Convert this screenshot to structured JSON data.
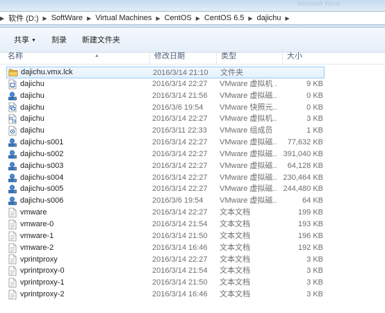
{
  "window": {
    "ghost_title": "Microsoft Word"
  },
  "address_bar": {
    "crumbs": [
      "软件 (D:)",
      "SoftWare",
      "Virtual Machines",
      "CentOS",
      "CentOS 6.5",
      "dajichu"
    ]
  },
  "toolbar": {
    "share_label": "共享",
    "burn_label": "刻录",
    "new_folder_label": "新建文件夹"
  },
  "columns": {
    "name": "名称",
    "modified": "修改日期",
    "type": "类型",
    "size": "大小"
  },
  "files": [
    {
      "name": "dajichu.vmx.lck",
      "date": "2016/3/14 21:10",
      "type": "文件夹",
      "size": "",
      "icon": "folder-icon"
    },
    {
      "name": "dajichu",
      "date": "2016/3/14 22:27",
      "type": "VMware 虚拟机 ...",
      "size": "9 KB",
      "icon": "vmx-file-icon"
    },
    {
      "name": "dajichu",
      "date": "2016/3/14 21:56",
      "type": "VMware 虚拟磁...",
      "size": "0 KB",
      "icon": "vmdk-file-icon"
    },
    {
      "name": "dajichu",
      "date": "2016/3/6 19:54",
      "type": "VMware 快照元...",
      "size": "0 KB",
      "icon": "vmsd-file-icon"
    },
    {
      "name": "dajichu",
      "date": "2016/3/14 22:27",
      "type": "VMware 虚拟机...",
      "size": "3 KB",
      "icon": "vmxf-file-icon"
    },
    {
      "name": "dajichu",
      "date": "2016/3/11 22:33",
      "type": "VMware 组成员",
      "size": "1 KB",
      "icon": "vmteam-file-icon"
    },
    {
      "name": "dajichu-s001",
      "date": "2016/3/14 22:27",
      "type": "VMware 虚拟磁...",
      "size": "77,632 KB",
      "icon": "vmdk-file-icon"
    },
    {
      "name": "dajichu-s002",
      "date": "2016/3/14 22:27",
      "type": "VMware 虚拟磁...",
      "size": "391,040 KB",
      "icon": "vmdk-file-icon"
    },
    {
      "name": "dajichu-s003",
      "date": "2016/3/14 22:27",
      "type": "VMware 虚拟磁...",
      "size": "64,128 KB",
      "icon": "vmdk-file-icon"
    },
    {
      "name": "dajichu-s004",
      "date": "2016/3/14 22:27",
      "type": "VMware 虚拟磁...",
      "size": "230,464 KB",
      "icon": "vmdk-file-icon"
    },
    {
      "name": "dajichu-s005",
      "date": "2016/3/14 22:27",
      "type": "VMware 虚拟磁...",
      "size": "244,480 KB",
      "icon": "vmdk-file-icon"
    },
    {
      "name": "dajichu-s006",
      "date": "2016/3/6 19:54",
      "type": "VMware 虚拟磁...",
      "size": "64 KB",
      "icon": "vmdk-file-icon"
    },
    {
      "name": "vmware",
      "date": "2016/3/14 22:27",
      "type": "文本文档",
      "size": "199 KB",
      "icon": "text-file-icon"
    },
    {
      "name": "vmware-0",
      "date": "2016/3/14 21:54",
      "type": "文本文档",
      "size": "193 KB",
      "icon": "text-file-icon"
    },
    {
      "name": "vmware-1",
      "date": "2016/3/14 21:50",
      "type": "文本文档",
      "size": "196 KB",
      "icon": "text-file-icon"
    },
    {
      "name": "vmware-2",
      "date": "2016/3/14 16:46",
      "type": "文本文档",
      "size": "192 KB",
      "icon": "text-file-icon"
    },
    {
      "name": "vprintproxy",
      "date": "2016/3/14 22:27",
      "type": "文本文档",
      "size": "3 KB",
      "icon": "text-file-icon"
    },
    {
      "name": "vprintproxy-0",
      "date": "2016/3/14 21:54",
      "type": "文本文档",
      "size": "3 KB",
      "icon": "text-file-icon"
    },
    {
      "name": "vprintproxy-1",
      "date": "2016/3/14 21:50",
      "type": "文本文档",
      "size": "3 KB",
      "icon": "text-file-icon"
    },
    {
      "name": "vprintproxy-2",
      "date": "2016/3/14 16:46",
      "type": "文本文档",
      "size": "3 KB",
      "icon": "text-file-icon"
    }
  ],
  "selected_index": 0,
  "colors": {
    "selection_border": "#9bcaf5",
    "vmware_blue": "#2a67b1",
    "folder_yellow": "#e8b53c"
  }
}
